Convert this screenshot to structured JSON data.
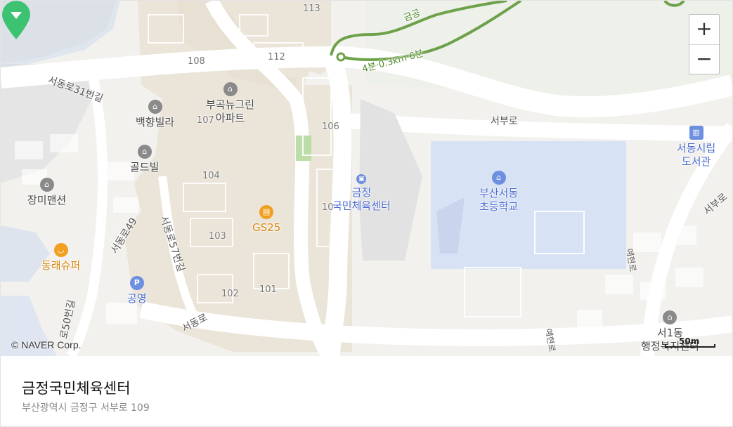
{
  "map": {
    "controls": {
      "zoom_in": "+",
      "zoom_out": "−"
    },
    "copyright": "© NAVER Corp.",
    "scale": "50m",
    "colors": {
      "route": "#6ea24a",
      "marker": "#3cc270",
      "poi_blue": "#4a6bd0",
      "school_block": "#d7e2f4"
    },
    "route_labels": [
      "4분·0.3km·6분",
      "금공"
    ],
    "roads": [
      "서동로31번길",
      "서부로",
      "서부로",
      "서동로",
      "서동로49",
      "서동로57번길",
      "로50번길",
      "예현로",
      "예현로"
    ],
    "blocks": [
      "113",
      "112",
      "108",
      "107",
      "106",
      "104",
      "103",
      "102",
      "101",
      "10"
    ],
    "pois": {
      "baekhyang": "백향빌라",
      "gold": "골드빌",
      "jangmi": "장미맨션",
      "bugok_1": "부곡뉴그린",
      "bugok_2": "아파트",
      "gs25": "GS25",
      "donglae": "동래슈퍼",
      "parking": "공영",
      "school_1": "부산서동",
      "school_2": "초등학교",
      "library_1": "서동시립",
      "library_2": "도서관",
      "office_1": "서1동",
      "office_2": "행정복지센터",
      "target_1": "금정",
      "target_2": "국민체육센터"
    }
  },
  "place": {
    "name": "금정국민체육센터",
    "address": "부산광역시 금정구 서부로 109"
  }
}
